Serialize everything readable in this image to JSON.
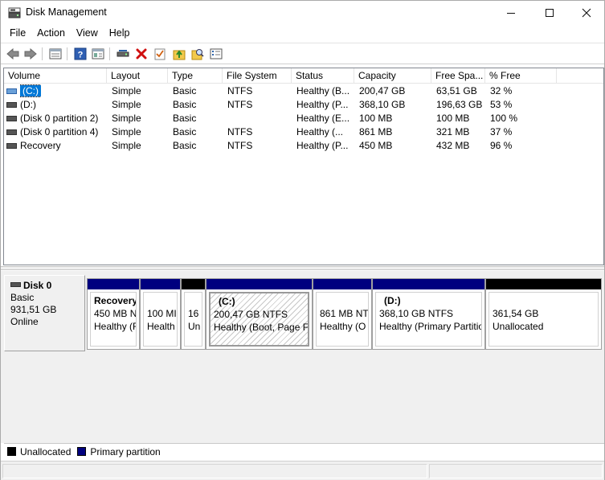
{
  "window": {
    "title": "Disk Management",
    "controls": {
      "minimize": "minimize-icon",
      "maximize": "maximize-icon",
      "close": "close-icon"
    }
  },
  "menu": [
    "File",
    "Action",
    "View",
    "Help"
  ],
  "toolbar": {
    "icons": [
      "back-arrow-icon",
      "forward-arrow-icon",
      "disk-list-icon",
      "help-icon",
      "properties-icon",
      "connect-drive-icon",
      "delete-icon",
      "check-icon",
      "up-folder-icon",
      "search-folder-icon",
      "settings-list-icon"
    ],
    "delete_color": "#d01010"
  },
  "volume_list": {
    "columns": [
      "Volume",
      "Layout",
      "Type",
      "File System",
      "Status",
      "Capacity",
      "Free Spa...",
      "% Free"
    ],
    "rows": [
      {
        "volume": "(C:)",
        "layout": "Simple",
        "type": "Basic",
        "fs": "NTFS",
        "status": "Healthy (B...",
        "capacity": "200,47 GB",
        "free": "63,51 GB",
        "pct": "32 %",
        "selected": true
      },
      {
        "volume": "(D:)",
        "layout": "Simple",
        "type": "Basic",
        "fs": "NTFS",
        "status": "Healthy (P...",
        "capacity": "368,10 GB",
        "free": "196,63 GB",
        "pct": "53 %",
        "selected": false
      },
      {
        "volume": "(Disk 0 partition 2)",
        "layout": "Simple",
        "type": "Basic",
        "fs": "",
        "status": "Healthy (E...",
        "capacity": "100 MB",
        "free": "100 MB",
        "pct": "100 %",
        "selected": false
      },
      {
        "volume": "(Disk 0 partition 4)",
        "layout": "Simple",
        "type": "Basic",
        "fs": "NTFS",
        "status": "Healthy (...",
        "capacity": "861 MB",
        "free": "321 MB",
        "pct": "37 %",
        "selected": false
      },
      {
        "volume": "Recovery",
        "layout": "Simple",
        "type": "Basic",
        "fs": "NTFS",
        "status": "Healthy (P...",
        "capacity": "450 MB",
        "free": "432 MB",
        "pct": "96 %",
        "selected": false
      }
    ]
  },
  "disk": {
    "name": "Disk 0",
    "type": "Basic",
    "size": "931,51 GB",
    "state": "Online",
    "partitions": [
      {
        "name": "Recovery",
        "line1": "450 MB N",
        "line2": "Healthy (F",
        "kind": "primary"
      },
      {
        "name": "",
        "line1": "100 MI",
        "line2": "Health",
        "kind": "primary"
      },
      {
        "name": "",
        "line1": "16",
        "line2": "Un",
        "kind": "unallocated"
      },
      {
        "name": "(C:)",
        "line1": "200,47 GB NTFS",
        "line2": "Healthy (Boot, Page Fi",
        "kind": "primary",
        "selected": true
      },
      {
        "name": "",
        "line1": "861 MB NT",
        "line2": "Healthy (O",
        "kind": "primary"
      },
      {
        "name": "(D:)",
        "line1": "368,10 GB NTFS",
        "line2": "Healthy (Primary Partitio",
        "kind": "primary"
      },
      {
        "name": "",
        "line1": "361,54 GB",
        "line2": "Unallocated",
        "kind": "unallocated"
      }
    ]
  },
  "legend": [
    {
      "label": "Unallocated",
      "color": "#000000"
    },
    {
      "label": "Primary partition",
      "color": "#00007f"
    }
  ],
  "colors": {
    "primary": "#00007f",
    "unallocated": "#000000",
    "selection": "#0078d7"
  }
}
